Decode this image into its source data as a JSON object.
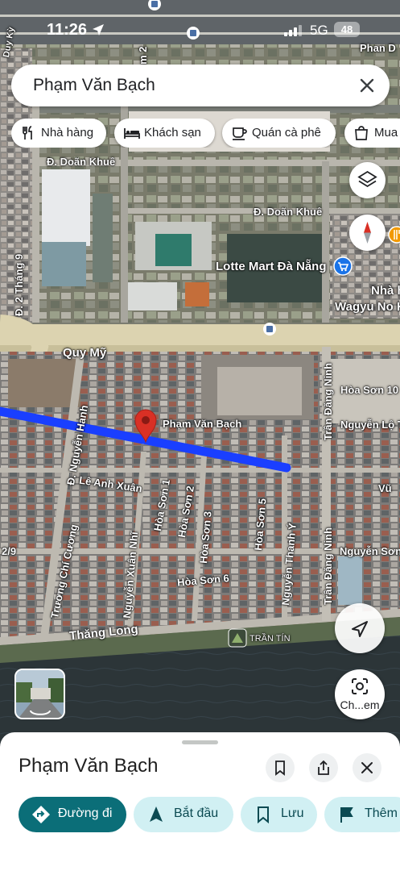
{
  "status_bar": {
    "time": "11:26",
    "network": "5G",
    "battery": "48"
  },
  "search": {
    "query": "Phạm Văn Bạch"
  },
  "chips": [
    {
      "label": "Nhà hàng",
      "icon": "restaurant-icon"
    },
    {
      "label": "Khách sạn",
      "icon": "hotel-icon"
    },
    {
      "label": "Quán cà phê",
      "icon": "coffee-icon"
    },
    {
      "label": "Mua",
      "icon": "shopping-bag-icon"
    }
  ],
  "map": {
    "labels": {
      "phan_d": "Phan D",
      "doan_khue_1": "Đ. Doãn Khuê",
      "doan_khue_2": "Đ. Doãn Khuê",
      "lotte": "Lotte Mart Đà Nẵng",
      "nha_h": "Nhà h",
      "wagyu": "Wagyu No K",
      "quy_my": "Quy Mỹ",
      "hoa_son_10": "Hòa Sơn 10",
      "nguyen_lo_t": "Nguyễn Lộ T",
      "pham_van_bach": "Phạm Văn Bạch",
      "tran_dang_ninh_1": "Trần Đăng Ninh",
      "tran_dang_ninh_2": "Trần Đăng Ninh",
      "le_anh_xuan": "Lê Anh Xuân",
      "nguyen_son": "Nguyễn Sơn",
      "hoa_son_6": "Hòa Sơn 6",
      "thang_long": "Thăng Long",
      "tran_tin": "TRẦN TÍN",
      "d2_thang9": "Đ. 2 Tháng 9",
      "nguyen_hanh": "Đ. Nguyễn Hanh",
      "hoa_son_1": "Hòa Sơn 1",
      "hoa_son_2": "Hòa Sơn 2",
      "hoa_son_3": "Hòa Sơn 3",
      "hoa_son_5": "Hòa Sơn 5",
      "nguyen_thanh_y": "Nguyễn Thanh Ý",
      "nguyen_xuan_nhi": "Nguyễn Xuân Nhĩ",
      "truong_chi_cuong": "Trương Chí Cương",
      "two_nine": "2/9",
      "vu": "Vũ",
      "duy_ky": "Duy Kỳ",
      "m2": "m 2"
    },
    "street_view_label": "Ch...em"
  },
  "sheet": {
    "title": "Phạm Văn Bạch",
    "actions": {
      "directions": "Đường đi",
      "start": "Bắt đầu",
      "save": "Lưu",
      "more": "Thêm"
    }
  },
  "colors": {
    "route": "#1a3fff",
    "accent": "#0b6e78",
    "pin": "#d93025"
  }
}
